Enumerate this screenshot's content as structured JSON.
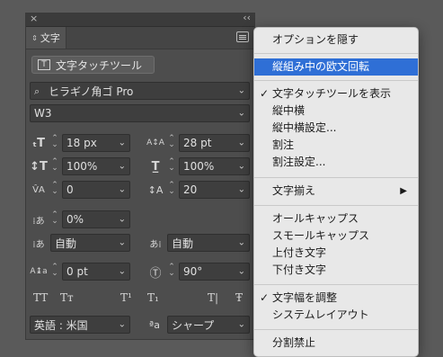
{
  "panel": {
    "title": "文字",
    "close_glyph": "×",
    "collapse_glyph": "‹‹",
    "touch_tool_label": "文字タッチツール",
    "font_family": "ヒラギノ角ゴ Pro",
    "font_style": "W3",
    "font_size": "18 px",
    "leading": "28 pt",
    "vertical_scale": "100%",
    "horizontal_scale": "100%",
    "kerning": "0",
    "tracking": "20",
    "tsume": "0%",
    "aki_before": "自動",
    "aki_after": "自動",
    "baseline_shift": "0 pt",
    "rotation": "90°",
    "language": "英語 : 米国",
    "antialias": "シャープ",
    "antialias_icon_text": "ªa",
    "type_styles": [
      "TT",
      "Tт",
      "T¹",
      "T₁",
      "T|",
      "Ŧ"
    ]
  },
  "menu": {
    "items": [
      {
        "label": "オプションを隠す"
      },
      {
        "label": "縦組み中の欧文回転",
        "highlighted": true
      },
      {
        "label": "文字タッチツールを表示",
        "checked": true
      },
      {
        "label": "縦中横"
      },
      {
        "label": "縦中横設定..."
      },
      {
        "label": "割注"
      },
      {
        "label": "割注設定..."
      },
      {
        "label": "文字揃え",
        "submenu": true
      },
      {
        "label": "オールキャップス"
      },
      {
        "label": "スモールキャップス"
      },
      {
        "label": "上付き文字"
      },
      {
        "label": "下付き文字"
      },
      {
        "label": "文字幅を調整",
        "checked": true
      },
      {
        "label": "システムレイアウト"
      },
      {
        "label": "分割禁止"
      }
    ],
    "check_glyph": "✓",
    "submenu_glyph": "▶",
    "highlight_color": "#2f6fd6"
  }
}
